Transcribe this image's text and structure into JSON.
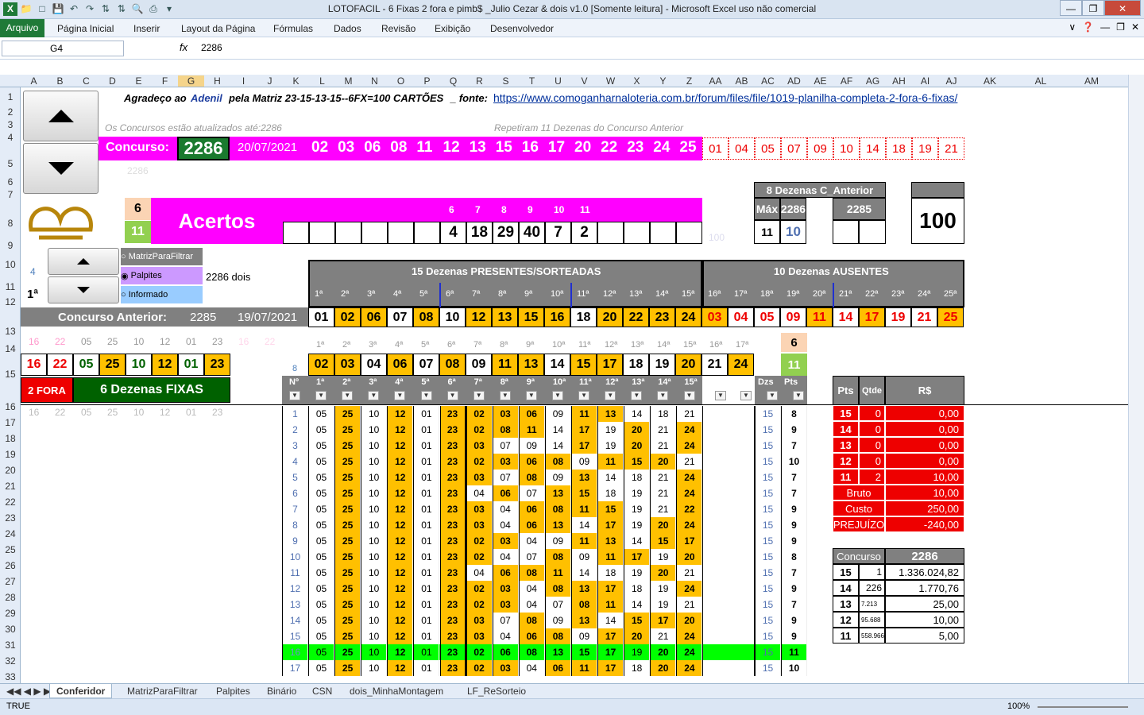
{
  "window": {
    "title": "LOTOFACIL - 6 Fixas 2 fora e pimb$ _Julio Cezar & dois v1.0  [Somente leitura] - Microsoft Excel uso não comercial"
  },
  "ribbon": {
    "file": "Arquivo",
    "tabs": [
      "Página Inicial",
      "Inserir",
      "Layout da Página",
      "Fórmulas",
      "Dados",
      "Revisão",
      "Exibição",
      "Desenvolvedor"
    ]
  },
  "formula": {
    "namebox": "G4",
    "fx": "fx",
    "value": "2286"
  },
  "columns": [
    "A",
    "B",
    "C",
    "D",
    "E",
    "F",
    "G",
    "H",
    "I",
    "J",
    "K",
    "L",
    "M",
    "N",
    "O",
    "P",
    "Q",
    "R",
    "S",
    "T",
    "U",
    "V",
    "W",
    "X",
    "Y",
    "Z",
    "AA",
    "AB",
    "AC",
    "AD",
    "AE",
    "AF",
    "AG",
    "AH",
    "AI",
    "AJ",
    "AK",
    "AL",
    "AM"
  ],
  "rows": [
    "1",
    "2",
    "3",
    "4",
    "5",
    "6",
    "7",
    "8",
    "9",
    "10",
    "11",
    "12",
    "13",
    "14",
    "15",
    "16",
    "17",
    "18",
    "19",
    "20",
    "21",
    "22",
    "23",
    "24",
    "25",
    "26",
    "27",
    "28",
    "29",
    "30",
    "31",
    "32",
    "33"
  ],
  "header": {
    "thanks": "Agradeço ao",
    "adenil": "Adenil",
    "matriz": "pela Matriz 23-15-13-15--6FX=100 CARTÕES",
    "fonte": "_ fonte:",
    "link": "https://www.comoganharnaloteria.com.br/forum/files/file/1019-planilha-completa-2-fora-6-fixas/",
    "updated": "Os Concursos estão atualizados até:2286",
    "repeat": "Repetiram 11 Dezenas do Concurso Anterior",
    "concurso_label": "Concurso:",
    "concurso": "2286",
    "date": "20/07/2021",
    "ghost": "2286",
    "drawn": [
      "02",
      "03",
      "06",
      "08",
      "11",
      "12",
      "13",
      "15",
      "16",
      "17",
      "20",
      "22",
      "23",
      "24",
      "25"
    ],
    "absent": [
      "01",
      "04",
      "05",
      "07",
      "09",
      "10",
      "14",
      "18",
      "19",
      "21"
    ]
  },
  "acertos": {
    "six": "6",
    "eleven": "11",
    "label": "Acertos",
    "heads": [
      "6",
      "7",
      "8",
      "9",
      "10",
      "11"
    ],
    "vals": [
      "4",
      "18",
      "29",
      "40",
      "7",
      "2"
    ],
    "ghost100": "100"
  },
  "anterior8": {
    "title": "8 Dezenas C_Anterior",
    "max": "Máx",
    "c1": "2286",
    "c2": "2285",
    "v1": "11",
    "v2": "10",
    "total": "100"
  },
  "opts": {
    "a": "MatrizParaFiltrar",
    "b": "Palpites",
    "c": "Informado",
    "note": "2286 dois",
    "four": "4",
    "first": "1ª"
  },
  "present": {
    "title": "15 Dezenas PRESENTES/SORTEADAS",
    "absent_title": "10 Dezenas AUSENTES",
    "pos": [
      "1ª",
      "2ª",
      "3ª",
      "4ª",
      "5ª",
      "6ª",
      "7ª",
      "8ª",
      "9ª",
      "10ª",
      "11ª",
      "12ª",
      "13ª",
      "14ª",
      "15ª",
      "16ª",
      "17ª",
      "18ª",
      "19ª",
      "20ª",
      "21ª",
      "22ª",
      "23ª",
      "24ª",
      "25ª"
    ]
  },
  "prev": {
    "label": "Concurso Anterior:",
    "num": "2285",
    "date": "19/07/2021",
    "nums": [
      "01",
      "02",
      "06",
      "07",
      "08",
      "10",
      "12",
      "13",
      "15",
      "16",
      "18",
      "20",
      "22",
      "23",
      "24",
      "03",
      "04",
      "05",
      "09",
      "11",
      "14",
      "17",
      "19",
      "21",
      "25"
    ]
  },
  "fixas": {
    "ghost": [
      "16",
      "22",
      "05",
      "25",
      "10",
      "12",
      "01",
      "23",
      "16",
      "22"
    ],
    "nums": [
      "16",
      "22",
      "05",
      "25",
      "10",
      "12",
      "01",
      "23"
    ],
    "fora": "2 FORA",
    "fixas": "6 Dezenas FIXAS",
    "ghost16": [
      "16",
      "22",
      "05",
      "25",
      "10",
      "12",
      "01",
      "23"
    ]
  },
  "row14": {
    "pos": [
      "1ª",
      "2ª",
      "3ª",
      "4ª",
      "5ª",
      "6ª",
      "7ª",
      "8ª",
      "9ª",
      "10ª",
      "11ª",
      "12ª",
      "13ª",
      "14ª",
      "15ª",
      "16ª",
      "17ª"
    ],
    "nums": [
      "02",
      "03",
      "04",
      "06",
      "07",
      "08",
      "09",
      "11",
      "13",
      "14",
      "15",
      "17",
      "18",
      "19",
      "20",
      "21",
      "24"
    ],
    "eight": "8",
    "six": "6",
    "eleven": "11"
  },
  "table": {
    "headers": [
      "Nº",
      "1ª",
      "2ª",
      "3ª",
      "4ª",
      "5ª",
      "6ª",
      "7ª",
      "8ª",
      "9ª",
      "10ª",
      "11ª",
      "12ª",
      "13ª",
      "14ª",
      "15ª"
    ],
    "dzs": "Dzs",
    "pts": "Pts",
    "rows": [
      [
        "1",
        "05",
        "25",
        "10",
        "12",
        "01",
        "23",
        "02",
        "03",
        "06",
        "09",
        "11",
        "13",
        "14",
        "18",
        "21",
        "15",
        "8"
      ],
      [
        "2",
        "05",
        "25",
        "10",
        "12",
        "01",
        "23",
        "02",
        "08",
        "11",
        "14",
        "17",
        "19",
        "20",
        "21",
        "24",
        "15",
        "9"
      ],
      [
        "3",
        "05",
        "25",
        "10",
        "12",
        "01",
        "23",
        "03",
        "07",
        "09",
        "14",
        "17",
        "19",
        "20",
        "21",
        "24",
        "15",
        "7"
      ],
      [
        "4",
        "05",
        "25",
        "10",
        "12",
        "01",
        "23",
        "02",
        "03",
        "06",
        "08",
        "09",
        "11",
        "15",
        "20",
        "21",
        "15",
        "10"
      ],
      [
        "5",
        "05",
        "25",
        "10",
        "12",
        "01",
        "23",
        "03",
        "07",
        "08",
        "09",
        "13",
        "14",
        "18",
        "21",
        "24",
        "15",
        "7"
      ],
      [
        "6",
        "05",
        "25",
        "10",
        "12",
        "01",
        "23",
        "04",
        "06",
        "07",
        "13",
        "15",
        "18",
        "19",
        "21",
        "24",
        "15",
        "7"
      ],
      [
        "7",
        "05",
        "25",
        "10",
        "12",
        "01",
        "23",
        "03",
        "04",
        "06",
        "08",
        "11",
        "15",
        "19",
        "21",
        "22",
        "15",
        "9"
      ],
      [
        "8",
        "05",
        "25",
        "10",
        "12",
        "01",
        "23",
        "03",
        "04",
        "06",
        "13",
        "14",
        "17",
        "19",
        "20",
        "24",
        "15",
        "9"
      ],
      [
        "9",
        "05",
        "25",
        "10",
        "12",
        "01",
        "23",
        "02",
        "03",
        "04",
        "09",
        "11",
        "13",
        "14",
        "15",
        "17",
        "15",
        "9"
      ],
      [
        "10",
        "05",
        "25",
        "10",
        "12",
        "01",
        "23",
        "02",
        "04",
        "07",
        "08",
        "09",
        "11",
        "17",
        "19",
        "20",
        "15",
        "8"
      ],
      [
        "11",
        "05",
        "25",
        "10",
        "12",
        "01",
        "23",
        "04",
        "06",
        "08",
        "11",
        "14",
        "18",
        "19",
        "20",
        "21",
        "15",
        "7"
      ],
      [
        "12",
        "05",
        "25",
        "10",
        "12",
        "01",
        "23",
        "02",
        "03",
        "04",
        "08",
        "13",
        "17",
        "18",
        "19",
        "24",
        "15",
        "9"
      ],
      [
        "13",
        "05",
        "25",
        "10",
        "12",
        "01",
        "23",
        "02",
        "03",
        "04",
        "07",
        "08",
        "11",
        "14",
        "19",
        "21",
        "15",
        "7"
      ],
      [
        "14",
        "05",
        "25",
        "10",
        "12",
        "01",
        "23",
        "03",
        "07",
        "08",
        "09",
        "13",
        "14",
        "15",
        "17",
        "20",
        "15",
        "9"
      ],
      [
        "15",
        "05",
        "25",
        "10",
        "12",
        "01",
        "23",
        "03",
        "04",
        "06",
        "08",
        "09",
        "17",
        "20",
        "21",
        "24",
        "15",
        "9"
      ],
      [
        "16",
        "05",
        "25",
        "10",
        "12",
        "01",
        "23",
        "02",
        "06",
        "08",
        "13",
        "15",
        "17",
        "19",
        "20",
        "24",
        "15",
        "11"
      ],
      [
        "17",
        "05",
        "25",
        "10",
        "12",
        "01",
        "23",
        "02",
        "03",
        "04",
        "06",
        "11",
        "17",
        "18",
        "20",
        "24",
        "15",
        "10"
      ]
    ]
  },
  "prize": {
    "head": [
      "Pts",
      "Qtde",
      "R$"
    ],
    "rows": [
      [
        "15",
        "0",
        "0,00"
      ],
      [
        "14",
        "0",
        "0,00"
      ],
      [
        "13",
        "0",
        "0,00"
      ],
      [
        "12",
        "0",
        "0,00"
      ],
      [
        "11",
        "2",
        "10,00"
      ]
    ],
    "bruto": "Bruto",
    "bruto_v": "10,00",
    "custo": "Custo",
    "custo_v": "250,00",
    "prej": "PREJUÍZO",
    "prej_v": "-240,00"
  },
  "concursoTbl": {
    "label": "Concurso",
    "num": "2286",
    "rows": [
      [
        "15",
        "1",
        "1.336.024,82"
      ],
      [
        "14",
        "226",
        "1.770,76"
      ],
      [
        "13",
        "7.213",
        "25,00"
      ],
      [
        "12",
        "95.688",
        "10,00"
      ],
      [
        "11",
        "558.966",
        "5,00"
      ]
    ]
  },
  "sheets": [
    "Conferidor",
    "MatrizParaFiltrar",
    "Palpites",
    "Binário",
    "CSN",
    "dois_MinhaMontagem",
    "LF_ReSorteio"
  ],
  "status": {
    "mode": "TRUE",
    "zoom": "100%"
  },
  "colors": {
    "magenta": "#ff00ff",
    "orange": "#ffc000",
    "green": "#00ff00",
    "darkgreen": "#006100",
    "red": "#ff0000",
    "gray": "#808080"
  }
}
